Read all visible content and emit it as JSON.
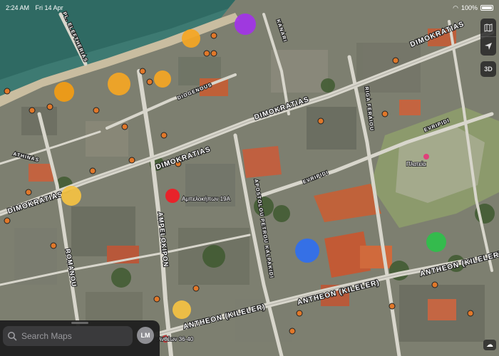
{
  "status_bar": {
    "time": "2:24 AM",
    "date": "Fri 14 Apr",
    "battery": "100%"
  },
  "map": {
    "streets": [
      {
        "name": "DIMOKRATIAS"
      },
      {
        "name": "DIMOKRATIAS"
      },
      {
        "name": "DIMOKRATIAS"
      },
      {
        "name": "DIMOKRATIAS"
      },
      {
        "name": "ANTHEON (KILELER)"
      },
      {
        "name": "ANTHEON (KILELER)"
      },
      {
        "name": "ANTHEON (KILELER)"
      },
      {
        "name": "PL. ELEFTHERIAS"
      },
      {
        "name": "DIOGENOUS"
      },
      {
        "name": "ATHINAS"
      },
      {
        "name": "ROMANOU"
      },
      {
        "name": "AMPELOKIPON"
      },
      {
        "name": "APOSTOLOU PETROU KALPAKIDI"
      },
      {
        "name": "RIGA FERAIOU"
      },
      {
        "name": "EVRIPIDI"
      },
      {
        "name": "EVRIPIDI"
      },
      {
        "name": "KANARI"
      }
    ],
    "pins": [
      {
        "label": "Αμπελοκήπων 19Α",
        "color": "#e8232a"
      },
      {
        "label": "Ανθέων 36-40",
        "color": "#e8232a"
      }
    ],
    "park_label": "Πλατεία",
    "markers": [
      {
        "color": "#a233e8"
      },
      {
        "color": "#f5a623"
      },
      {
        "color": "#f5a623"
      },
      {
        "color": "#f5a623"
      },
      {
        "color": "#f39c12"
      },
      {
        "color": "#f5c242"
      },
      {
        "color": "#f5c242"
      },
      {
        "color": "#2f6ff0"
      },
      {
        "color": "#2ec04a"
      }
    ]
  },
  "controls": {
    "threeD_label": "3D"
  },
  "search": {
    "placeholder": "Search Maps",
    "avatar_initials": "LM"
  },
  "weather": {
    "icon": "cloud-icon"
  }
}
